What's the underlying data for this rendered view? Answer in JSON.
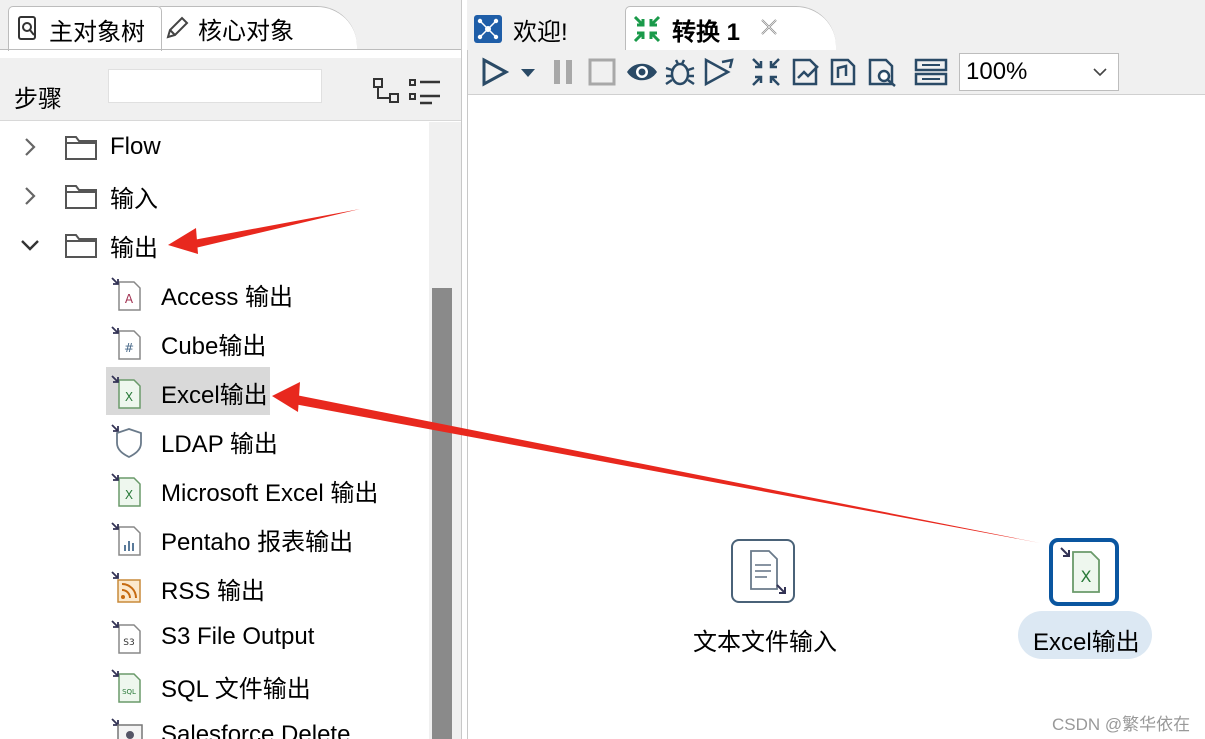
{
  "left_panel": {
    "tabs": [
      {
        "label": "主对象树",
        "icon": "tree-search-icon"
      },
      {
        "label": "核心对象",
        "icon": "pencil-icon"
      }
    ],
    "steps_label": "步骤",
    "search_value": "",
    "tree": {
      "folders": [
        {
          "label": "Flow",
          "expanded": false
        },
        {
          "label": "输入",
          "expanded": false
        },
        {
          "label": "输出",
          "expanded": true
        }
      ],
      "steps": [
        {
          "label": "Access 输出",
          "icon": "access-output-icon",
          "glyph": "A"
        },
        {
          "label": "Cube输出",
          "icon": "cube-output-icon",
          "glyph": "#"
        },
        {
          "label": "Excel输出",
          "icon": "excel-output-icon",
          "glyph": "X",
          "selected": true
        },
        {
          "label": "LDAP 输出",
          "icon": "ldap-output-icon",
          "glyph": ""
        },
        {
          "label": "Microsoft Excel 输出",
          "icon": "microsoft-excel-output-icon",
          "glyph": "X"
        },
        {
          "label": "Pentaho 报表输出",
          "icon": "pentaho-report-output-icon",
          "glyph": ""
        },
        {
          "label": "RSS 输出",
          "icon": "rss-output-icon",
          "glyph": ""
        },
        {
          "label": "S3 File Output",
          "icon": "s3-file-output-icon",
          "glyph": "S3"
        },
        {
          "label": "SQL 文件输出",
          "icon": "sql-file-output-icon",
          "glyph": "SQL"
        },
        {
          "label": "Salesforce Delete",
          "icon": "salesforce-delete-icon",
          "glyph": ""
        }
      ]
    }
  },
  "right_panel": {
    "tabs": [
      {
        "label": "欢迎!",
        "icon": "welcome-icon"
      },
      {
        "label": "转换 1",
        "icon": "transformation-icon",
        "active": true
      }
    ],
    "zoom_value": "100%",
    "toolbar_icons": [
      "run-icon",
      "run-dropdown-icon",
      "pause-icon",
      "stop-icon",
      "preview-icon",
      "debug-icon",
      "replay-icon",
      "verify-icon",
      "impact-icon",
      "sql-icon",
      "explore-db-icon",
      "show-results-icon"
    ],
    "canvas_nodes": [
      {
        "label": "文本文件输入",
        "icon": "text-file-input-icon"
      },
      {
        "label": "Excel输出",
        "icon": "excel-output-icon",
        "highlighted": true
      }
    ]
  },
  "watermark": "CSDN @繁华依在",
  "colors": {
    "annotation_arrow": "#e8281e",
    "selection": "#d9d9d9",
    "node_highlight": "#0a56a0",
    "scroll_thumb": "#8a8a8a"
  }
}
